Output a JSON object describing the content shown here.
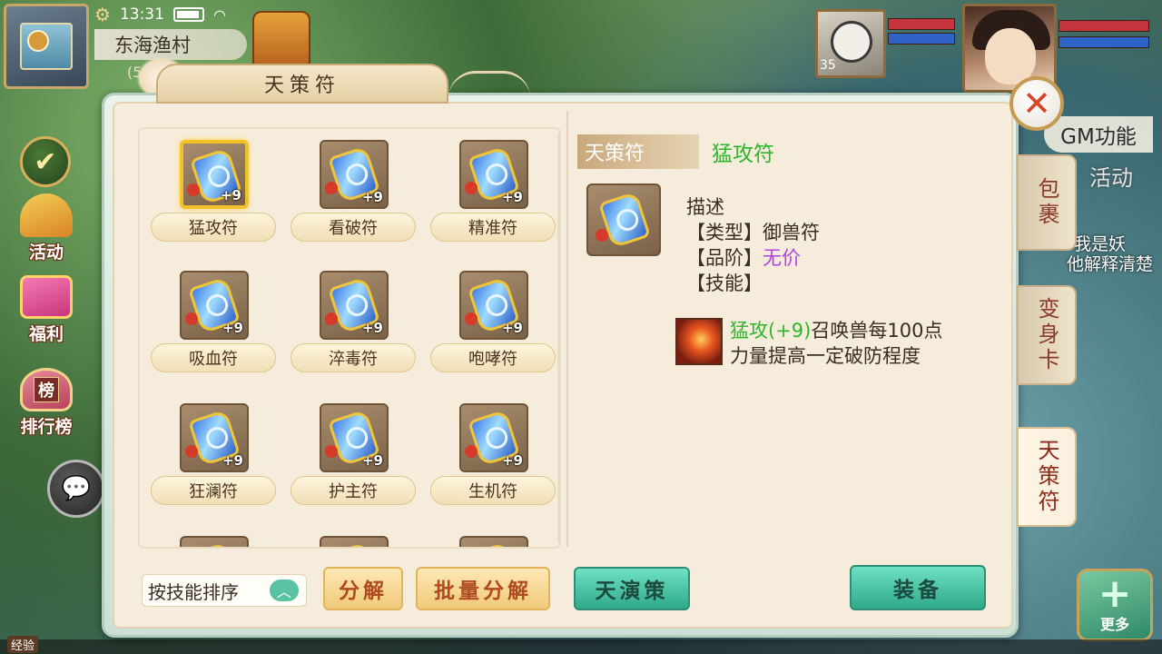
{
  "hud": {
    "time": "13:31",
    "location": "东海渔村",
    "coords_fragment": "(5",
    "pet_level": "35",
    "hero_level": "",
    "side_buttons": {
      "huodong": "活动",
      "fuli": "福利",
      "rank": "排行榜",
      "rank_badge": "榜"
    },
    "gm_label": "GM功能",
    "huodong_right": "活动",
    "npc_text_1": "我是妖",
    "npc_text_2": "他解释清楚",
    "more_label": "更多",
    "exp_label": "经验"
  },
  "panel": {
    "title": "天策符",
    "close_icon": "close-icon"
  },
  "items": [
    {
      "name": "猛攻符",
      "level": "+9",
      "selected": true
    },
    {
      "name": "看破符",
      "level": "+9",
      "selected": false
    },
    {
      "name": "精准符",
      "level": "+9",
      "selected": false
    },
    {
      "name": "吸血符",
      "level": "+9",
      "selected": false
    },
    {
      "name": "淬毒符",
      "level": "+9",
      "selected": false
    },
    {
      "name": "咆哮符",
      "level": "+9",
      "selected": false
    },
    {
      "name": "狂澜符",
      "level": "+9",
      "selected": false
    },
    {
      "name": "护主符",
      "level": "+9",
      "selected": false
    },
    {
      "name": "生机符",
      "level": "+9",
      "selected": false
    }
  ],
  "detail": {
    "category_tag": "天策符",
    "item_name": "猛攻符",
    "desc_title": "描述",
    "type_label": "【类型】",
    "type_value": "御兽符",
    "grade_label": "【品阶】",
    "grade_value": "无价",
    "skill_label": "【技能】",
    "skill_highlight": "猛攻(+9)",
    "skill_text_1": "召唤兽每100点",
    "skill_text_2": "力量提高一定破防程度"
  },
  "controls": {
    "sort_label": "按技能排序",
    "split_label": "分解",
    "batch_split_label": "批量分解",
    "tianyan_label": "天演策",
    "equip_label": "装备"
  },
  "side_tabs": {
    "bag": "包裹",
    "transform_card": "变身卡",
    "talisman": "天策符"
  },
  "colors": {
    "accent_green": "#2fb52c",
    "grade_purple": "#b43fe6",
    "selected_border": "#f2c12a",
    "teal_button": "#2fa98a"
  }
}
